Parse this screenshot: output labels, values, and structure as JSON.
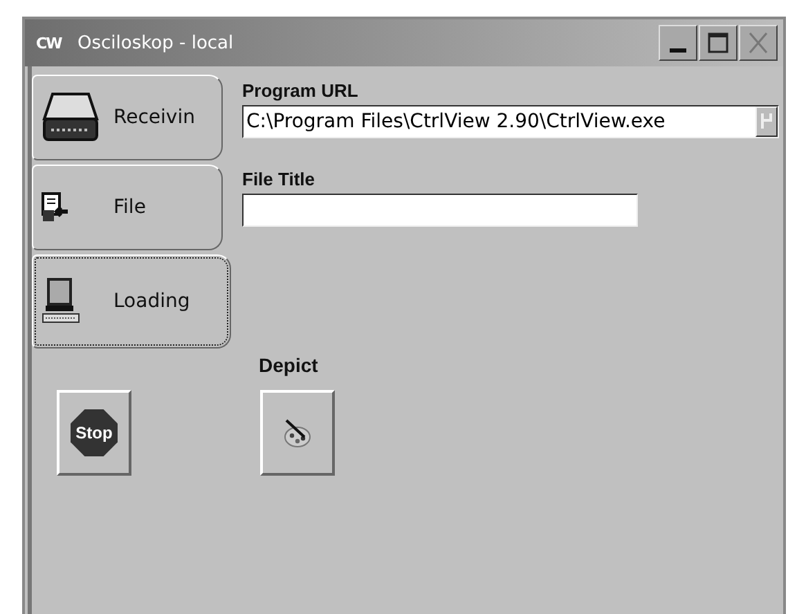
{
  "window": {
    "title": "Osciloskop - local",
    "app_icon": "CW"
  },
  "tabs": [
    {
      "label": "Receivin",
      "kind": "drive",
      "selected": false
    },
    {
      "label": "File",
      "kind": "file",
      "selected": false
    },
    {
      "label": "Loading",
      "kind": "computer",
      "selected": true
    }
  ],
  "fields": [
    {
      "label": "Program URL",
      "value": "C:\\Program Files\\CtrlView 2.90\\CtrlView.exe",
      "browse": true
    },
    {
      "label": "File Title",
      "browse": false
    }
  ],
  "buttons": [
    {
      "kind": "stop",
      "icon_text": "Stop"
    },
    {
      "kind": "palette",
      "label": "Depict"
    }
  ]
}
